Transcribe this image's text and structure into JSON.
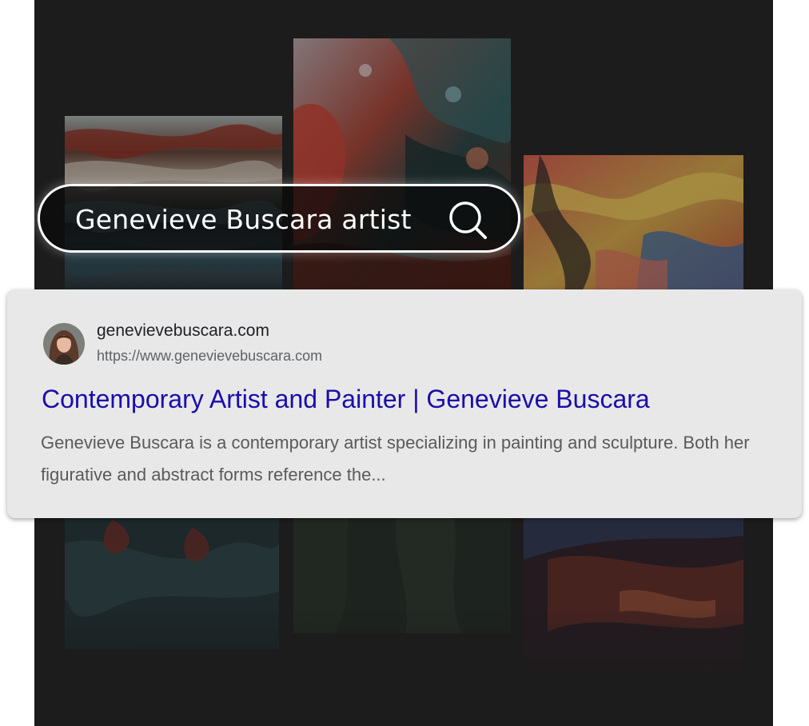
{
  "search": {
    "query": "Genevieve Buscara artist",
    "icon": "search-icon"
  },
  "result": {
    "site_name": "genevievebuscara.com",
    "site_url": "https://www.genevievebuscara.com",
    "title": "Contemporary Artist and Painter | Genevieve Buscara",
    "snippet": "Genevieve Buscara is a contemporary artist specializing in painting and sculpture. Both her figurative and abstract forms reference the...",
    "avatar_icon": "avatar"
  },
  "colors": {
    "background": "#1c1c1c",
    "card": "#e8e8e8",
    "title_link": "#1a0dab",
    "url": "#5f6368",
    "search_border": "#ffffff"
  },
  "gallery": {
    "tiles": [
      {
        "name": "marbled-blue-red-artwork"
      },
      {
        "name": "fluid-red-teal-artwork"
      },
      {
        "name": "fluid-orange-yellow-artwork"
      },
      {
        "name": "abstract-dark-teal-artwork"
      },
      {
        "name": "abstract-dark-green-artwork"
      },
      {
        "name": "abstract-dark-red-artwork"
      }
    ]
  }
}
